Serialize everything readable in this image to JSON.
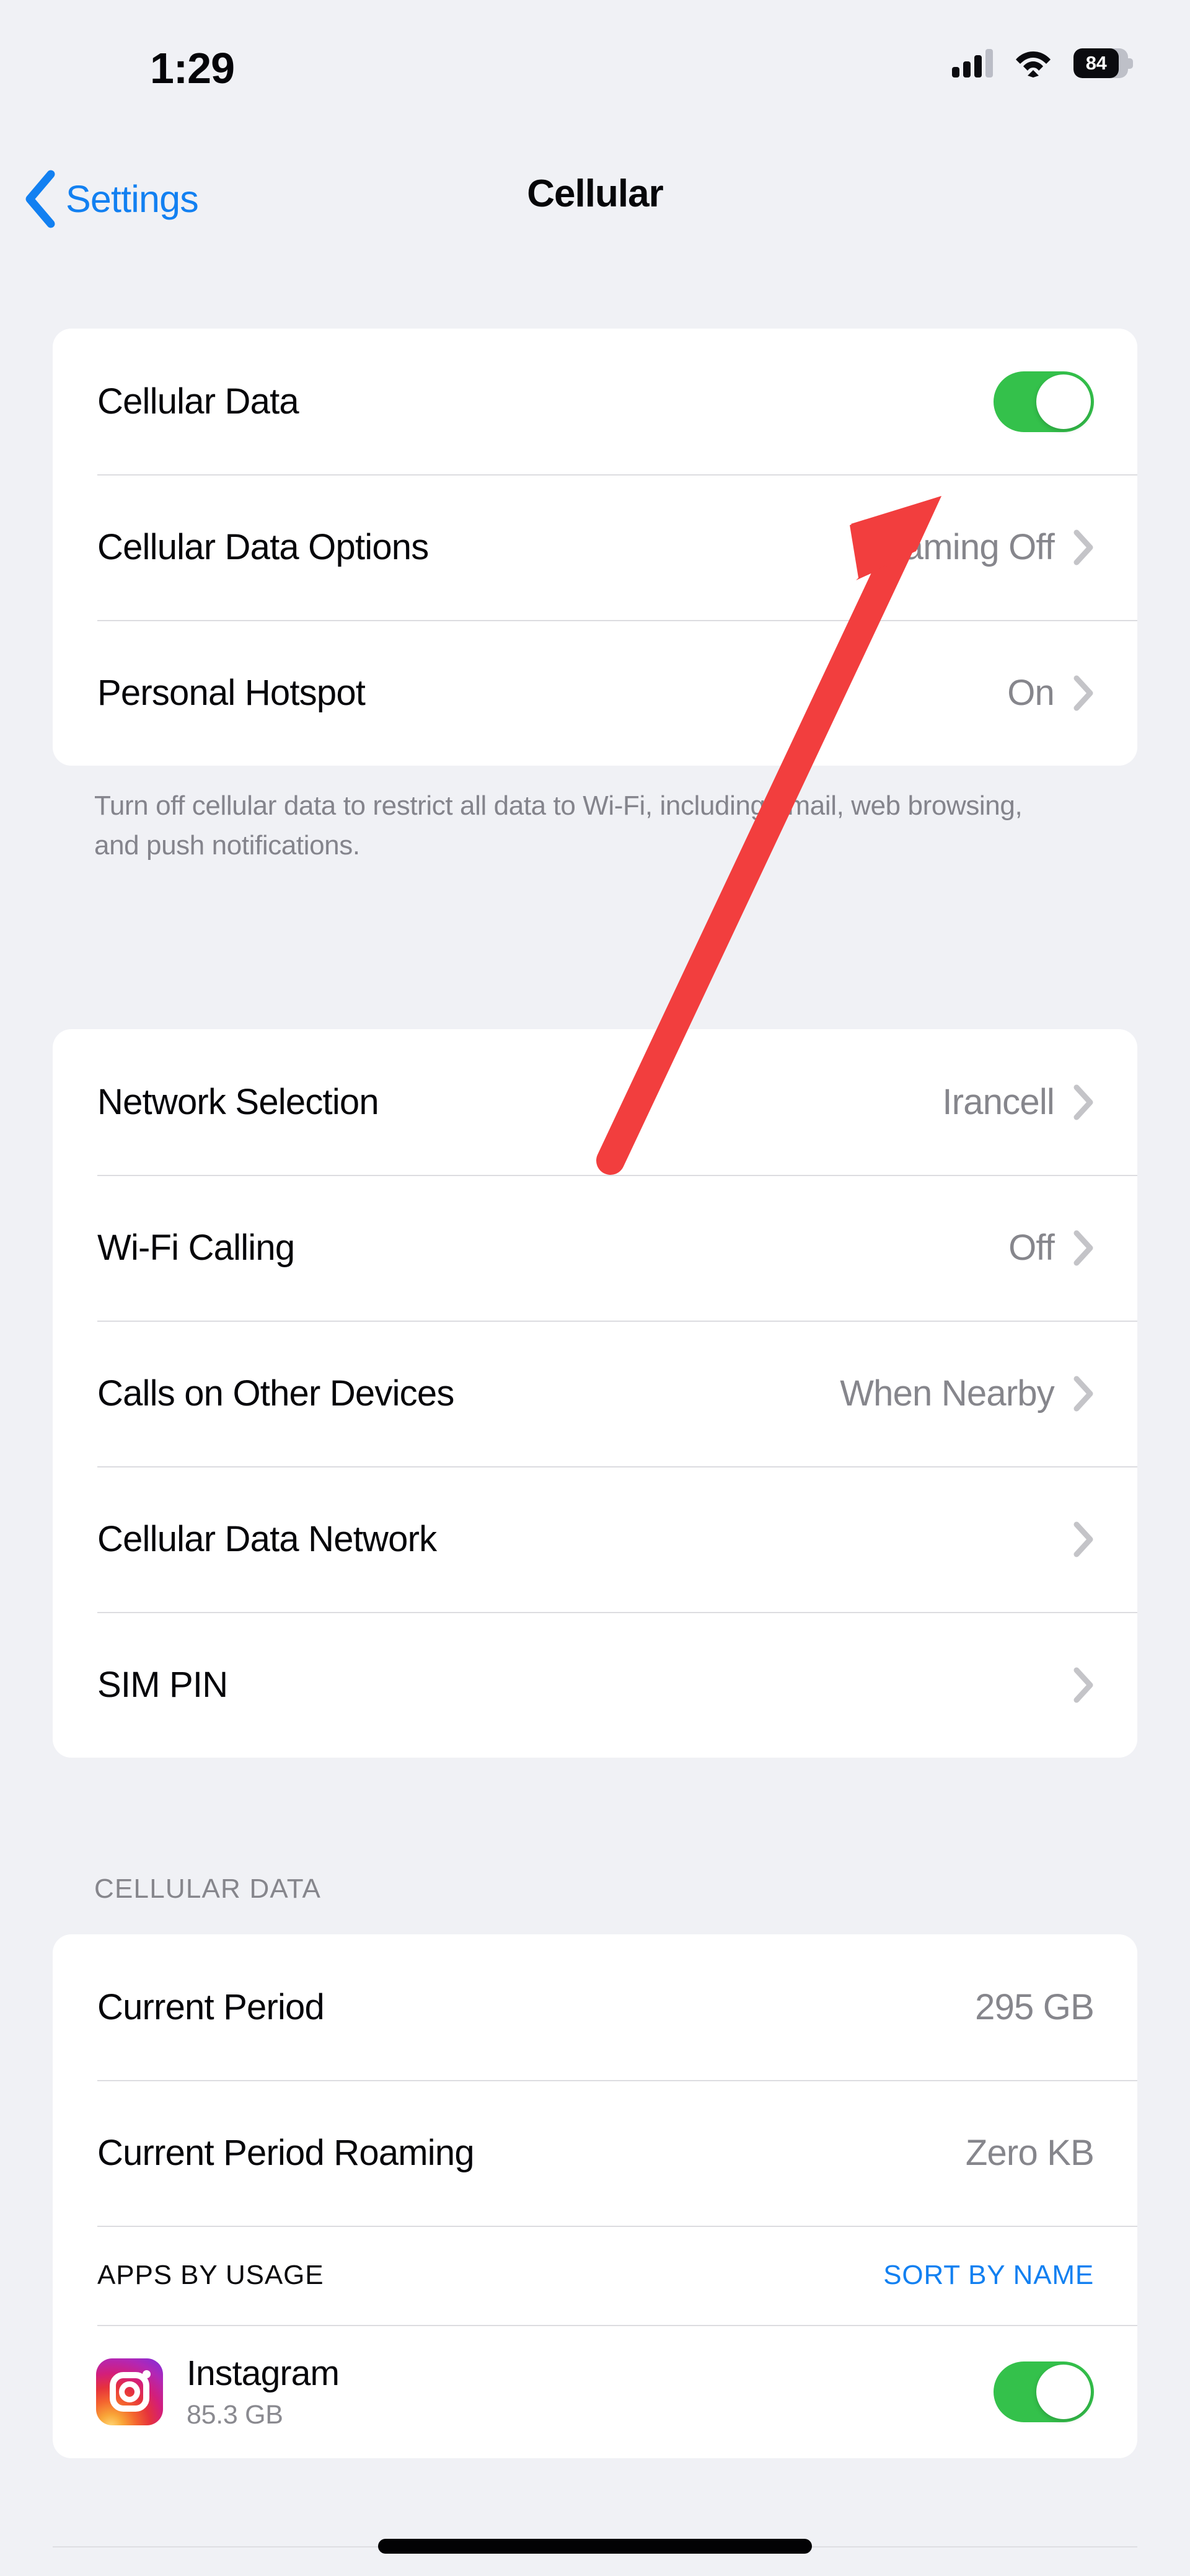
{
  "status_bar": {
    "time": "1:29",
    "signal_icon": "cellular-signal-icon",
    "signal_bars_filled": 3,
    "signal_bars_total": 4,
    "wifi_icon": "wifi-icon",
    "battery_percent": "84",
    "battery_icon": "battery-icon"
  },
  "nav": {
    "back_label": "Settings",
    "back_icon": "chevron-left-icon",
    "title": "Cellular"
  },
  "sections": {
    "data_card": {
      "rows": [
        {
          "label": "Cellular Data",
          "control": "toggle",
          "toggle_on": true
        },
        {
          "label": "Cellular Data Options",
          "value": "Roaming Off",
          "control": "chevron"
        },
        {
          "label": "Personal Hotspot",
          "value": "On",
          "control": "chevron"
        }
      ],
      "footnote": "Turn off cellular data to restrict all data to Wi-Fi, including email, web browsing, and push notifications."
    },
    "network_card": {
      "rows": [
        {
          "label": "Network Selection",
          "value": "Irancell",
          "control": "chevron"
        },
        {
          "label": "Wi-Fi Calling",
          "value": "Off",
          "control": "chevron"
        },
        {
          "label": "Calls on Other Devices",
          "value": "When Nearby",
          "control": "chevron"
        },
        {
          "label": "Cellular Data Network",
          "value": "",
          "control": "chevron"
        },
        {
          "label": "SIM PIN",
          "value": "",
          "control": "chevron"
        }
      ]
    },
    "usage": {
      "header": "CELLULAR DATA",
      "rows": [
        {
          "label": "Current Period",
          "value": "295 GB"
        },
        {
          "label": "Current Period Roaming",
          "value": "Zero KB"
        }
      ],
      "apps_header": "APPS BY USAGE",
      "sort_label": "SORT BY NAME",
      "apps": [
        {
          "name": "Instagram",
          "size": "85.3 GB",
          "icon": "instagram-icon",
          "toggle_on": true
        }
      ]
    }
  },
  "annotation": {
    "type": "arrow",
    "color": "#F23E3E",
    "points_to": "Cellular Data toggle"
  },
  "colors": {
    "accent_blue": "#1280F1",
    "toggle_green": "#34C14B",
    "background": "#F0F1F5",
    "card": "#FFFFFF",
    "secondary_text": "#86868C",
    "annotation_red": "#F23E3E"
  },
  "home_indicator": "home-indicator"
}
